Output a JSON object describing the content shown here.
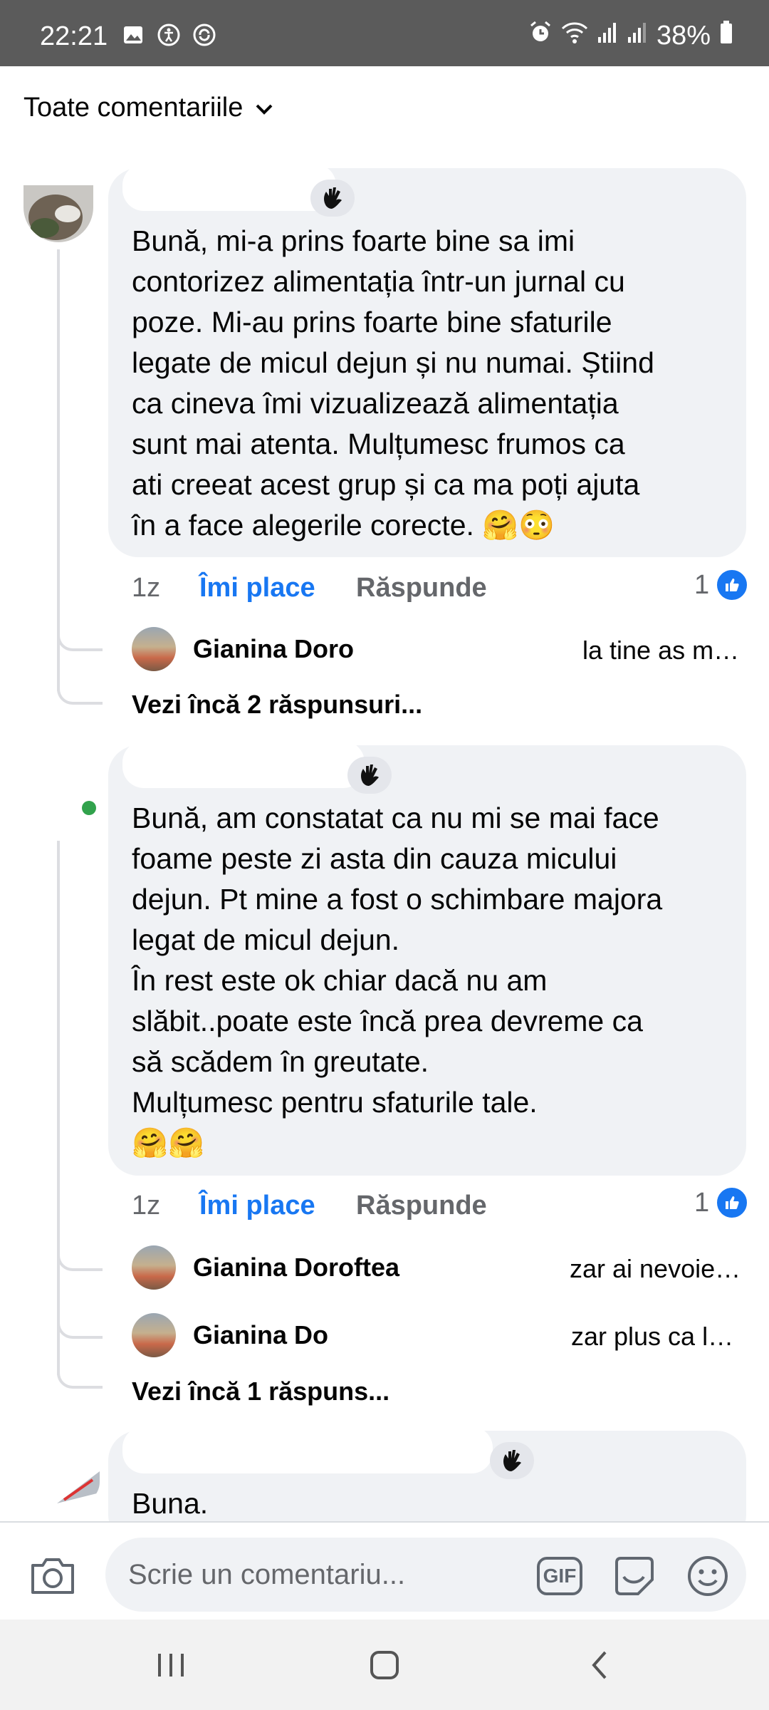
{
  "status_bar": {
    "time": "22:21",
    "battery": "38%",
    "left_icons": [
      "image-icon",
      "accessibility-icon",
      "sync-icon"
    ],
    "right_icons": [
      "alarm-icon",
      "wifi-icon",
      "signal-icon",
      "signal-icon",
      "battery-icon"
    ]
  },
  "filter": {
    "label": "Toate comentariile",
    "icon": "chevron-down-icon"
  },
  "comments": [
    {
      "badge_icon": "wave-hand-icon",
      "text": "Bună, mi-a prins foarte bine sa imi\ncontorizez alimentația într-un jurnal cu\npoze. Mi-au prins foarte bine sfaturile\nlegate de micul dejun și nu numai. Știind\nca cineva îmi vizualizează alimentația\nsunt mai atenta. Mulțumesc frumos ca\nati creeat acest grup și ca ma poți ajuta\nîn a face alegerile corecte. 🤗😳",
      "time": "1z",
      "like": "Îmi place",
      "reply": "Răspunde",
      "reaction_count": "1",
      "replies": [
        {
          "name": "Gianina Doro",
          "text": "la tine as m…"
        }
      ],
      "more": "Vezi încă 2 răspunsuri..."
    },
    {
      "badge_icon": "wave-hand-icon",
      "text": "Bună, am constatat ca nu mi se mai face\nfoame peste zi asta din cauza micului\ndejun. Pt mine a fost o schimbare majora\nlegat de micul dejun.\nÎn rest este ok chiar dacă nu am\nslăbit..poate este încă prea devreme ca\nsă scădem în greutate.\nMulțumesc pentru sfaturile tale.\n🤗🤗",
      "time": "1z",
      "like": "Îmi place",
      "reply": "Răspunde",
      "reaction_count": "1",
      "replies": [
        {
          "name": "Gianina Doroftea",
          "text": "zar ai nevoie…"
        },
        {
          "name": "Gianina Do",
          "text": "zar plus ca l…"
        }
      ],
      "more": "Vezi încă 1 răspuns..."
    },
    {
      "badge_icon": "wave-hand-icon",
      "text": "Buna."
    }
  ],
  "composer": {
    "placeholder": "Scrie un comentariu...",
    "gif": "GIF",
    "icons": [
      "camera-icon",
      "gif-icon",
      "sticker-icon",
      "emoji-icon"
    ]
  },
  "nav": {
    "icons": [
      "recent-apps-icon",
      "home-icon",
      "back-icon"
    ]
  }
}
